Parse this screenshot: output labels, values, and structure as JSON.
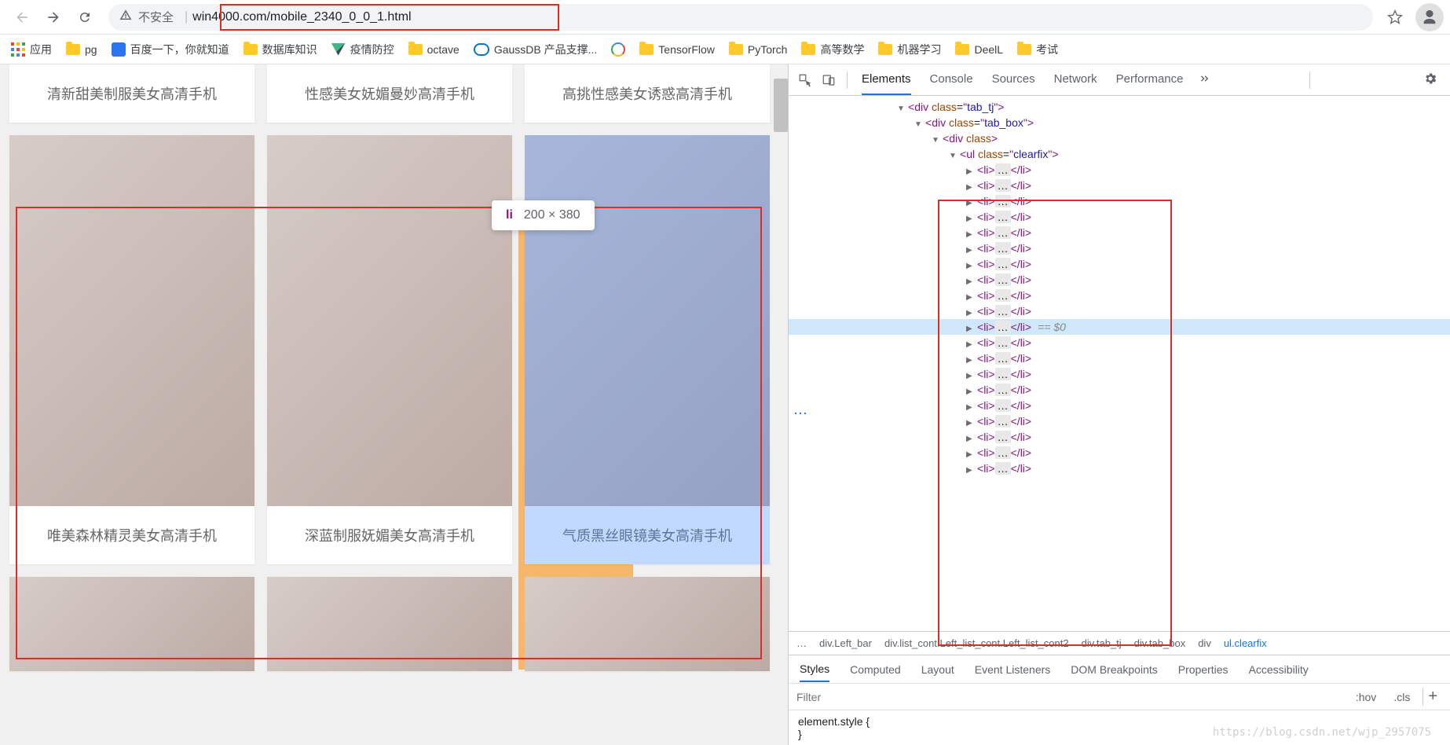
{
  "browser": {
    "url_insecure_label": "不安全",
    "url": "win4000.com/mobile_2340_0_0_1.html"
  },
  "bookmarks": [
    {
      "type": "apps",
      "label": "应用"
    },
    {
      "type": "folder",
      "label": "pg"
    },
    {
      "type": "baidu",
      "label": "百度一下，你就知道"
    },
    {
      "type": "folder",
      "label": "数据库知识"
    },
    {
      "type": "vue",
      "label": "疫情防控"
    },
    {
      "type": "folder",
      "label": "octave"
    },
    {
      "type": "gauss",
      "label": "GaussDB 产品支撑..."
    },
    {
      "type": "google",
      "label": ""
    },
    {
      "type": "folder",
      "label": "TensorFlow"
    },
    {
      "type": "folder",
      "label": "PyTorch"
    },
    {
      "type": "folder",
      "label": "高等数学"
    },
    {
      "type": "folder",
      "label": "机器学习"
    },
    {
      "type": "folder",
      "label": "DeelL"
    },
    {
      "type": "folder",
      "label": "考试"
    }
  ],
  "tooltip": {
    "tag": "li",
    "dims": "200 × 380"
  },
  "gallery": {
    "row1": [
      {
        "caption": "清新甜美制服美女高清手机"
      },
      {
        "caption": "性感美女妩媚曼妙高清手机"
      },
      {
        "caption": "高挑性感美女诱惑高清手机"
      }
    ],
    "row2": [
      {
        "caption": "唯美森林精灵美女高清手机",
        "cls": "img-fairy"
      },
      {
        "caption": "深蓝制服妩媚美女高清手机",
        "cls": "img-office"
      },
      {
        "caption": "气质黑丝眼镜美女高清手机",
        "cls": "img-model",
        "selected": true
      }
    ]
  },
  "devtools": {
    "tabs": [
      "Elements",
      "Console",
      "Sources",
      "Network",
      "Performance"
    ],
    "tree": {
      "prelude": "<div class=\"tab_tj\">",
      "tab_box": "tab_box",
      "class_attr": "class",
      "div": "div",
      "ul": "ul",
      "li": "li",
      "clearfix": "clearfix",
      "selvar": "== $0",
      "li_count": 20
    },
    "crumbs": [
      "…",
      "div.Left_bar",
      "div.list_cont.Left_list_cont.Left_list_cont2",
      "div.tab_tj",
      "div.tab_box",
      "div",
      "ul.clearfix"
    ],
    "styles_tabs": [
      "Styles",
      "Computed",
      "Layout",
      "Event Listeners",
      "DOM Breakpoints",
      "Properties",
      "Accessibility"
    ],
    "filter_placeholder": "Filter",
    "hov": ":hov",
    "cls": ".cls",
    "element_style": "element.style {",
    "element_style_close": "}"
  },
  "watermark": "https://blog.csdn.net/wjp_2957075"
}
